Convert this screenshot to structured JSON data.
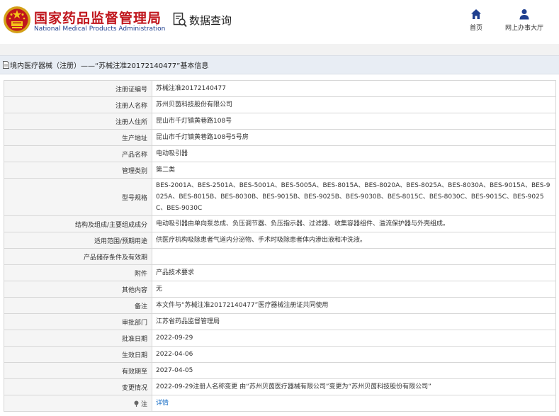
{
  "header": {
    "brand_cn": "国家药品监督管理局",
    "brand_en": "National Medical Products Administration",
    "query_label": "数据查询",
    "nav": {
      "home_label": "首页",
      "office_label": "网上办事大厅"
    }
  },
  "section": {
    "title": "境内医疗器械（注册）——“苏械注准20172140477”基本信息"
  },
  "colors": {
    "brand_red": "#c0161d",
    "brand_blue": "#1f3f8f",
    "link_blue": "#1a6fc7",
    "label_bg": "#f5f5f5"
  },
  "rows": [
    {
      "label": "注册证编号",
      "value": "苏械注准20172140477"
    },
    {
      "label": "注册人名称",
      "value": "苏州贝茵科技股份有限公司"
    },
    {
      "label": "注册人住所",
      "value": "昆山市千灯镇黄巷路108号"
    },
    {
      "label": "生产地址",
      "value": "昆山市千灯镇黄巷路108号5号房"
    },
    {
      "label": "产品名称",
      "value": "电动吸引器"
    },
    {
      "label": "管理类别",
      "value": "第二类"
    },
    {
      "label": "型号规格",
      "value": "BES-2001A、BES-2501A、BES-5001A、BES-5005A、BES-8015A、BES-8020A、BES-8025A、BES-8030A、BES-9015A、BES-9025A、BES-8015B、BES-8030B、BES-9015B、BES-9025B、BES-9030B、BES-8015C、BES-8030C、BES-9015C、BES-9025C、BES-9030C"
    },
    {
      "label": "结构及组成/主要组成成分",
      "value": "电动吸引器由单向泵总成、负压调节器、负压指示器、过滤器、收集容器组件、溢流保护器与外壳组成。"
    },
    {
      "label": "适用范围/预期用途",
      "value": "供医疗机构吸除患者气道内分泌物、手术时吸除患者体内渗出液和冲洗液。"
    },
    {
      "label": "产品储存条件及有效期",
      "value": ""
    },
    {
      "label": "附件",
      "value": "产品技术要求"
    },
    {
      "label": "其他内容",
      "value": "无"
    },
    {
      "label": "备注",
      "value": "本文件与“苏械注准20172140477”医疗器械注册证共同使用"
    },
    {
      "label": "审批部门",
      "value": "江苏省药品监督管理局"
    },
    {
      "label": "批准日期",
      "value": "2022-09-29"
    },
    {
      "label": "生效日期",
      "value": "2022-04-06"
    },
    {
      "label": "有效期至",
      "value": "2027-04-05"
    },
    {
      "label": "变更情况",
      "value": "2022-09-29注册人名称变更 由“苏州贝茵医疗器械有限公司”变更为“苏州贝茵科技股份有限公司”"
    },
    {
      "label": "注",
      "value": "详情"
    }
  ]
}
